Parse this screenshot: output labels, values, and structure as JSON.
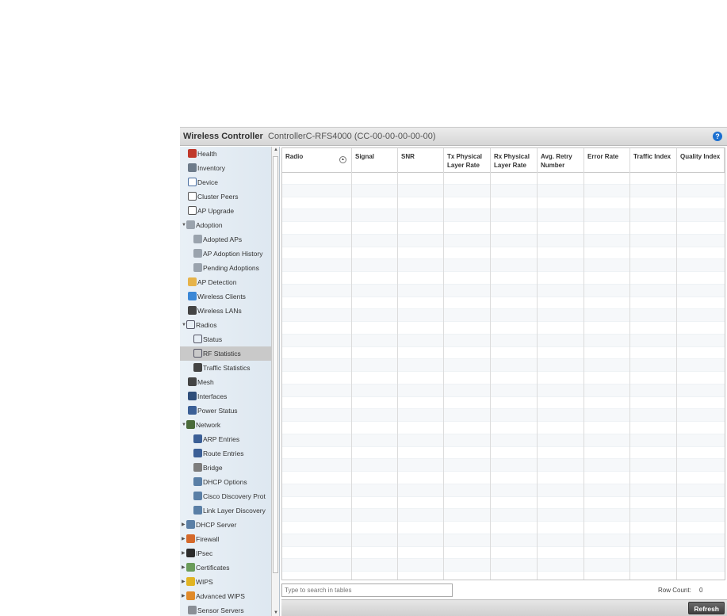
{
  "header": {
    "app_title": "Wireless Controller",
    "controller": "ControllerC-RFS4000 (CC-00-00-00-00-00)",
    "help": "?"
  },
  "sidebar": {
    "items": [
      {
        "label": "Health",
        "icon": "health-icon",
        "level": 1
      },
      {
        "label": "Inventory",
        "icon": "inventory-icon",
        "level": 1
      },
      {
        "label": "Device",
        "icon": "device-icon",
        "level": 1
      },
      {
        "label": "Cluster Peers",
        "icon": "cluster-icon",
        "level": 1
      },
      {
        "label": "AP Upgrade",
        "icon": "upgrade-icon",
        "level": 1
      },
      {
        "label": "Adoption",
        "icon": "adoption-icon",
        "level": 0,
        "expanded": true
      },
      {
        "label": "Adopted APs",
        "icon": "adoption-icon",
        "level": 2
      },
      {
        "label": "AP Adoption History",
        "icon": "adoption-icon",
        "level": 2
      },
      {
        "label": "Pending Adoptions",
        "icon": "adoption-icon",
        "level": 2
      },
      {
        "label": "AP Detection",
        "icon": "ap-detection-icon",
        "level": 1
      },
      {
        "label": "Wireless Clients",
        "icon": "client-icon",
        "level": 1
      },
      {
        "label": "Wireless LANs",
        "icon": "wlan-icon",
        "level": 1
      },
      {
        "label": "Radios",
        "icon": "radio-icon",
        "level": 0,
        "expanded": true
      },
      {
        "label": "Status",
        "icon": "radio-icon",
        "level": 2
      },
      {
        "label": "RF Statistics",
        "icon": "radio-icon",
        "level": 2,
        "selected": true
      },
      {
        "label": "Traffic Statistics",
        "icon": "traffic-icon",
        "level": 2
      },
      {
        "label": "Mesh",
        "icon": "mesh-icon",
        "level": 1
      },
      {
        "label": "Interfaces",
        "icon": "interfaces-icon",
        "level": 1
      },
      {
        "label": "Power Status",
        "icon": "power-icon",
        "level": 1
      },
      {
        "label": "Network",
        "icon": "network-icon",
        "level": 0,
        "expanded": true
      },
      {
        "label": "ARP Entries",
        "icon": "arp-icon",
        "level": 2
      },
      {
        "label": "Route Entries",
        "icon": "route-icon",
        "level": 2
      },
      {
        "label": "Bridge",
        "icon": "bridge-icon",
        "level": 2
      },
      {
        "label": "DHCP Options",
        "icon": "dhcp-icon",
        "level": 2
      },
      {
        "label": "Cisco Discovery Prot",
        "icon": "dhcp-icon",
        "level": 2
      },
      {
        "label": "Link Layer Discovery",
        "icon": "dhcp-icon",
        "level": 2
      },
      {
        "label": "DHCP Server",
        "icon": "dhcp-icon",
        "level": 0,
        "expanded": false
      },
      {
        "label": "Firewall",
        "icon": "firewall-icon",
        "level": 0,
        "expanded": false
      },
      {
        "label": "IPsec",
        "icon": "ipsec-icon",
        "level": 0,
        "expanded": false
      },
      {
        "label": "Certificates",
        "icon": "certificate-icon",
        "level": 0,
        "expanded": false
      },
      {
        "label": "WIPS",
        "icon": "wips-icon",
        "level": 0,
        "expanded": false
      },
      {
        "label": "Advanced WIPS",
        "icon": "advanced-wips-icon",
        "level": 0,
        "expanded": false
      },
      {
        "label": "Sensor Servers",
        "icon": "sensor-icon",
        "level": 1
      }
    ]
  },
  "table": {
    "columns": [
      {
        "label": "Radio",
        "sortable": true
      },
      {
        "label": "Signal"
      },
      {
        "label": "SNR"
      },
      {
        "label": "Tx Physical Layer Rate"
      },
      {
        "label": "Rx Physical Layer Rate"
      },
      {
        "label": "Avg. Retry Number"
      },
      {
        "label": "Error Rate"
      },
      {
        "label": "Traffic Index"
      },
      {
        "label": "Quality Index"
      }
    ],
    "rows": []
  },
  "footer": {
    "search_placeholder": "Type to search in tables",
    "row_count_label": "Row Count:",
    "row_count_value": "0",
    "refresh_label": "Refresh"
  }
}
